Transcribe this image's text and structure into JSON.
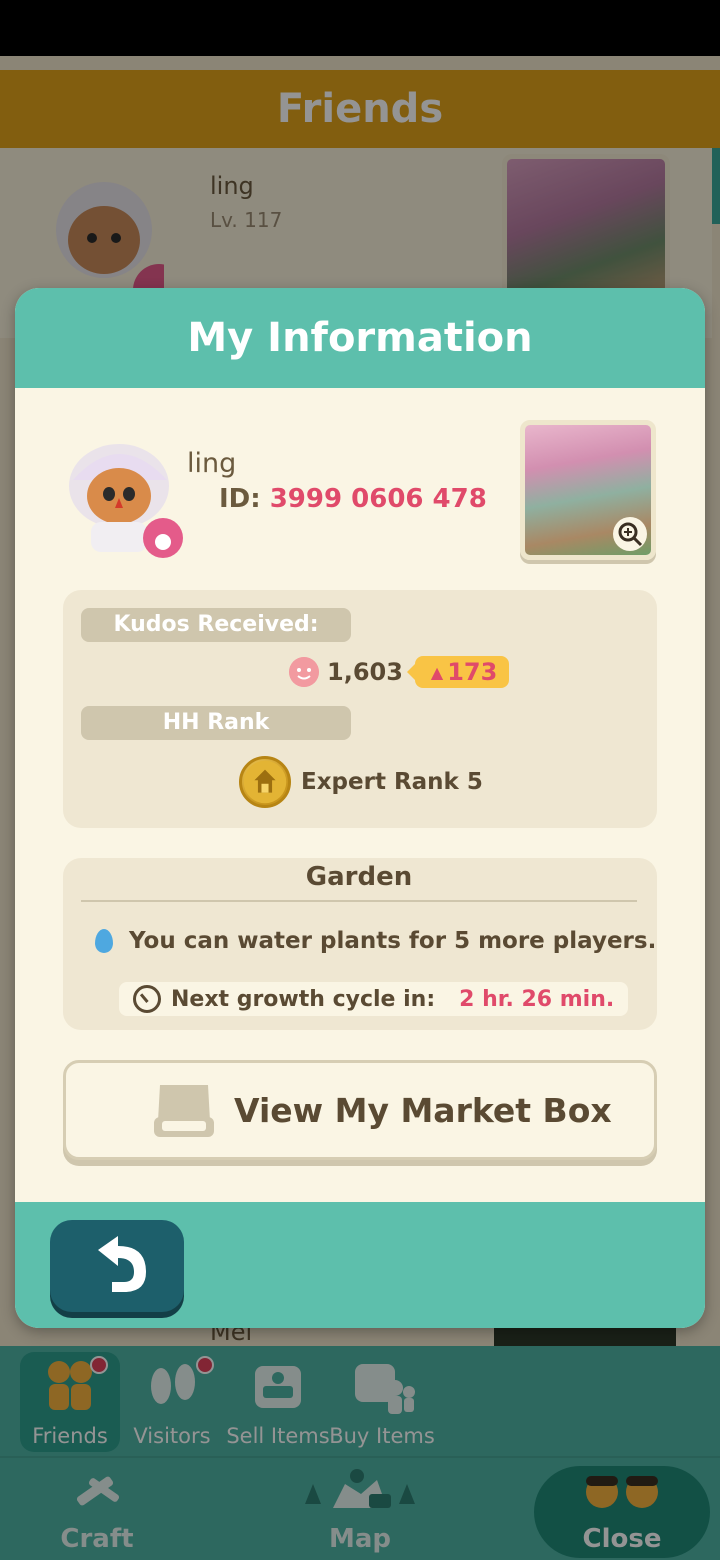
{
  "background": {
    "header_title": "Friends",
    "friend_name": "ling",
    "friend_level": "Lv. 117",
    "next_friend_name": "Mei"
  },
  "modal": {
    "title": "My Information",
    "name": "ling",
    "id_label": "ID:",
    "id_value": "3999 0606 478",
    "kudos": {
      "label": "Kudos Received:",
      "count": "1,603",
      "increase": "173"
    },
    "hh_rank": {
      "label": "HH Rank",
      "value": "Expert Rank 5"
    },
    "garden": {
      "title": "Garden",
      "water_text": "You can water plants for 5 more players.",
      "growth_label": "Next growth cycle in:",
      "growth_value": "2 hr. 26 min."
    },
    "market_button_label": "View My Market Box"
  },
  "footer": {
    "tabs": [
      {
        "label": "Friends",
        "active": true,
        "notification": true
      },
      {
        "label": "Visitors",
        "active": false,
        "notification": true
      },
      {
        "label": "Sell Items",
        "active": false,
        "notification": false
      },
      {
        "label": "Buy Items",
        "active": false,
        "notification": false
      }
    ],
    "bottom": [
      {
        "label": "Craft"
      },
      {
        "label": "Map"
      },
      {
        "label": "Close"
      }
    ]
  },
  "colors": {
    "accent_teal": "#5dbfac",
    "header_orange": "#e0a21a",
    "highlight_pink": "#e04a6a",
    "badge_yellow": "#f9c445",
    "back_button": "#1d5f6b"
  },
  "icons": [
    "back-arrow-icon",
    "zoom-icon",
    "kudos-face-icon",
    "hh-rank-medal-icon",
    "water-drop-icon",
    "clock-icon",
    "market-box-icon",
    "friends-icon",
    "visitors-icon",
    "sell-items-icon",
    "buy-items-icon",
    "craft-icon",
    "map-icon",
    "close-icon"
  ]
}
